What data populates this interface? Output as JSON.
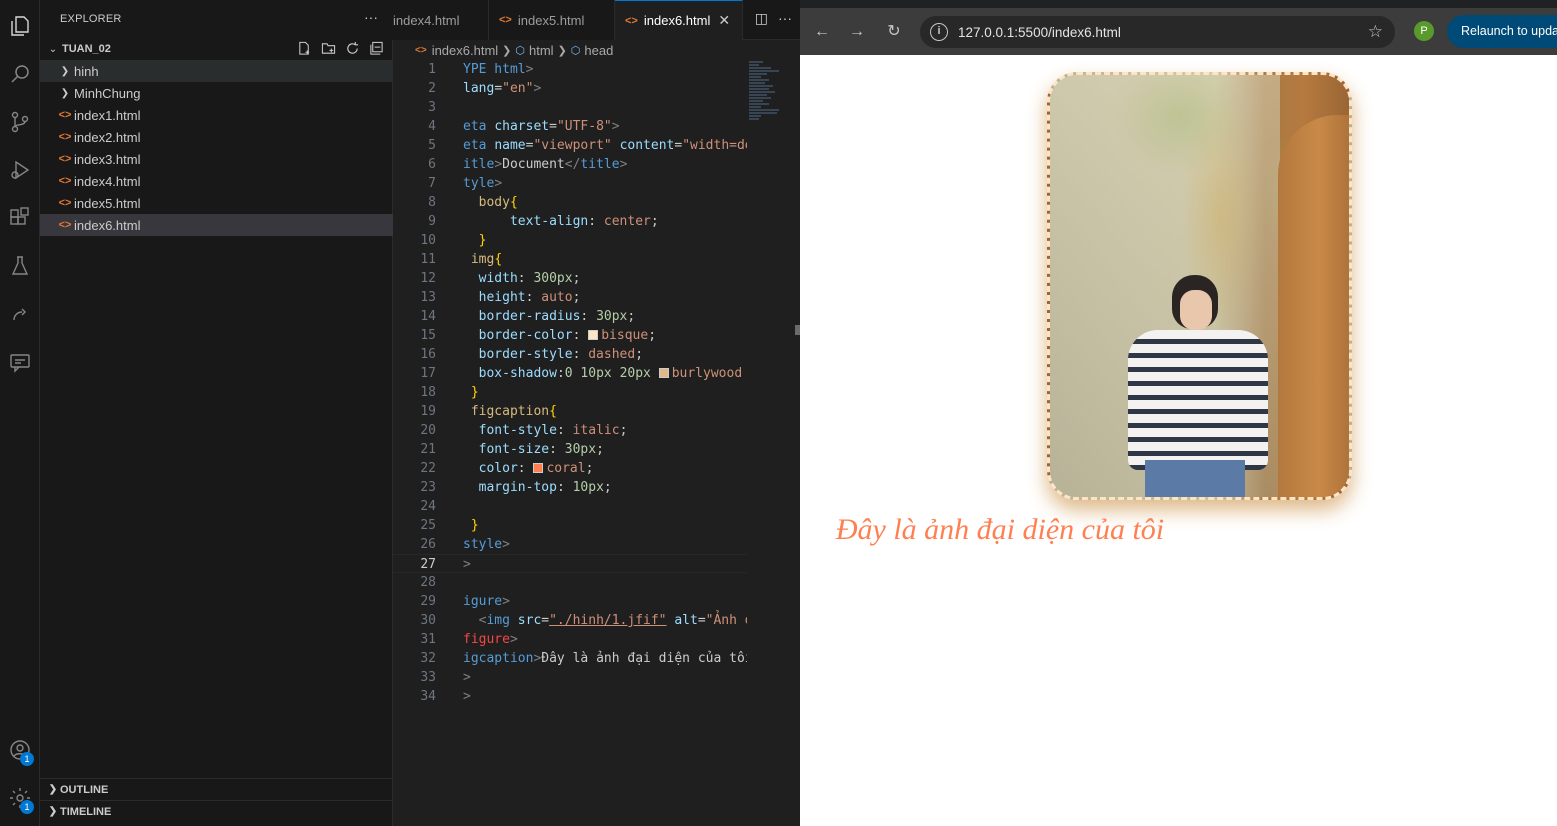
{
  "sidebar": {
    "header": "EXPLORER",
    "folder": "TUAN_02",
    "items": [
      {
        "label": "hinh",
        "kind": "folder"
      },
      {
        "label": "MinhChung",
        "kind": "folder"
      },
      {
        "label": "index1.html",
        "kind": "html"
      },
      {
        "label": "index2.html",
        "kind": "html"
      },
      {
        "label": "index3.html",
        "kind": "html"
      },
      {
        "label": "index4.html",
        "kind": "html"
      },
      {
        "label": "index5.html",
        "kind": "html"
      },
      {
        "label": "index6.html",
        "kind": "html"
      }
    ],
    "outline": "OUTLINE",
    "timeline": "TIMELINE"
  },
  "activity": {
    "accounts_badge": "1",
    "settings_badge": "1"
  },
  "editor": {
    "tabs": [
      {
        "label": "index4.html"
      },
      {
        "label": "index5.html"
      },
      {
        "label": "index6.html"
      }
    ],
    "breadcrumb": {
      "file": "index6.html",
      "b1": "html",
      "b2": "head"
    },
    "current_line": "27"
  },
  "browser": {
    "url": "127.0.0.1:5500/index6.html",
    "profile_initial": "P",
    "relaunch_label": "Relaunch to update",
    "caption": "Đây là ảnh đại diện của tôi"
  },
  "colors": {
    "bisque": "#ffe4c4",
    "burlywood": "#deb887",
    "coral": "#ff7f50",
    "accent": "#0078d4"
  }
}
